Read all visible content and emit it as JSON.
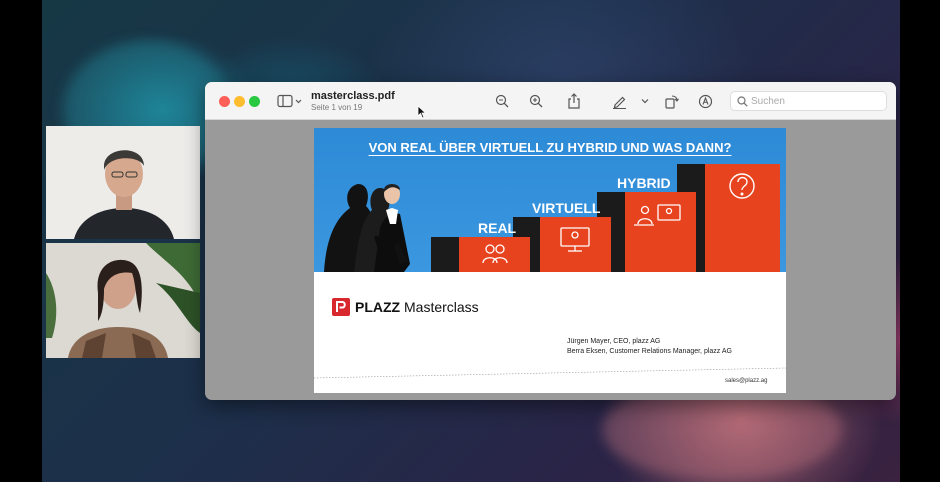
{
  "document": {
    "filename": "masterclass.pdf",
    "page_info": "Seite 1 von 19"
  },
  "toolbar": {
    "search_placeholder": "Suchen"
  },
  "slide": {
    "heading": "VON REAL ÜBER VIRTUELL ZU HYBRID UND WAS DANN?",
    "steps": [
      "REAL",
      "VIRTUELL",
      "HYBRID"
    ],
    "brand_name": "PLAZZ",
    "brand_suffix": "Masterclass",
    "presenters": [
      "Jürgen Mayer, CEO, plazz AG",
      "Berra Eksen, Customer Relations Manager, plazz AG"
    ],
    "contact": "sales@plazz.ag",
    "colors": {
      "sky": "#3b97df",
      "step": "#e8431f",
      "logo": "#d9272e"
    }
  },
  "icons": [
    "sidebar-icon",
    "zoom-out-icon",
    "zoom-in-icon",
    "share-icon",
    "markup-icon",
    "rotate-icon",
    "annotate-icon",
    "search-icon",
    "cursor-icon",
    "help-icon"
  ]
}
